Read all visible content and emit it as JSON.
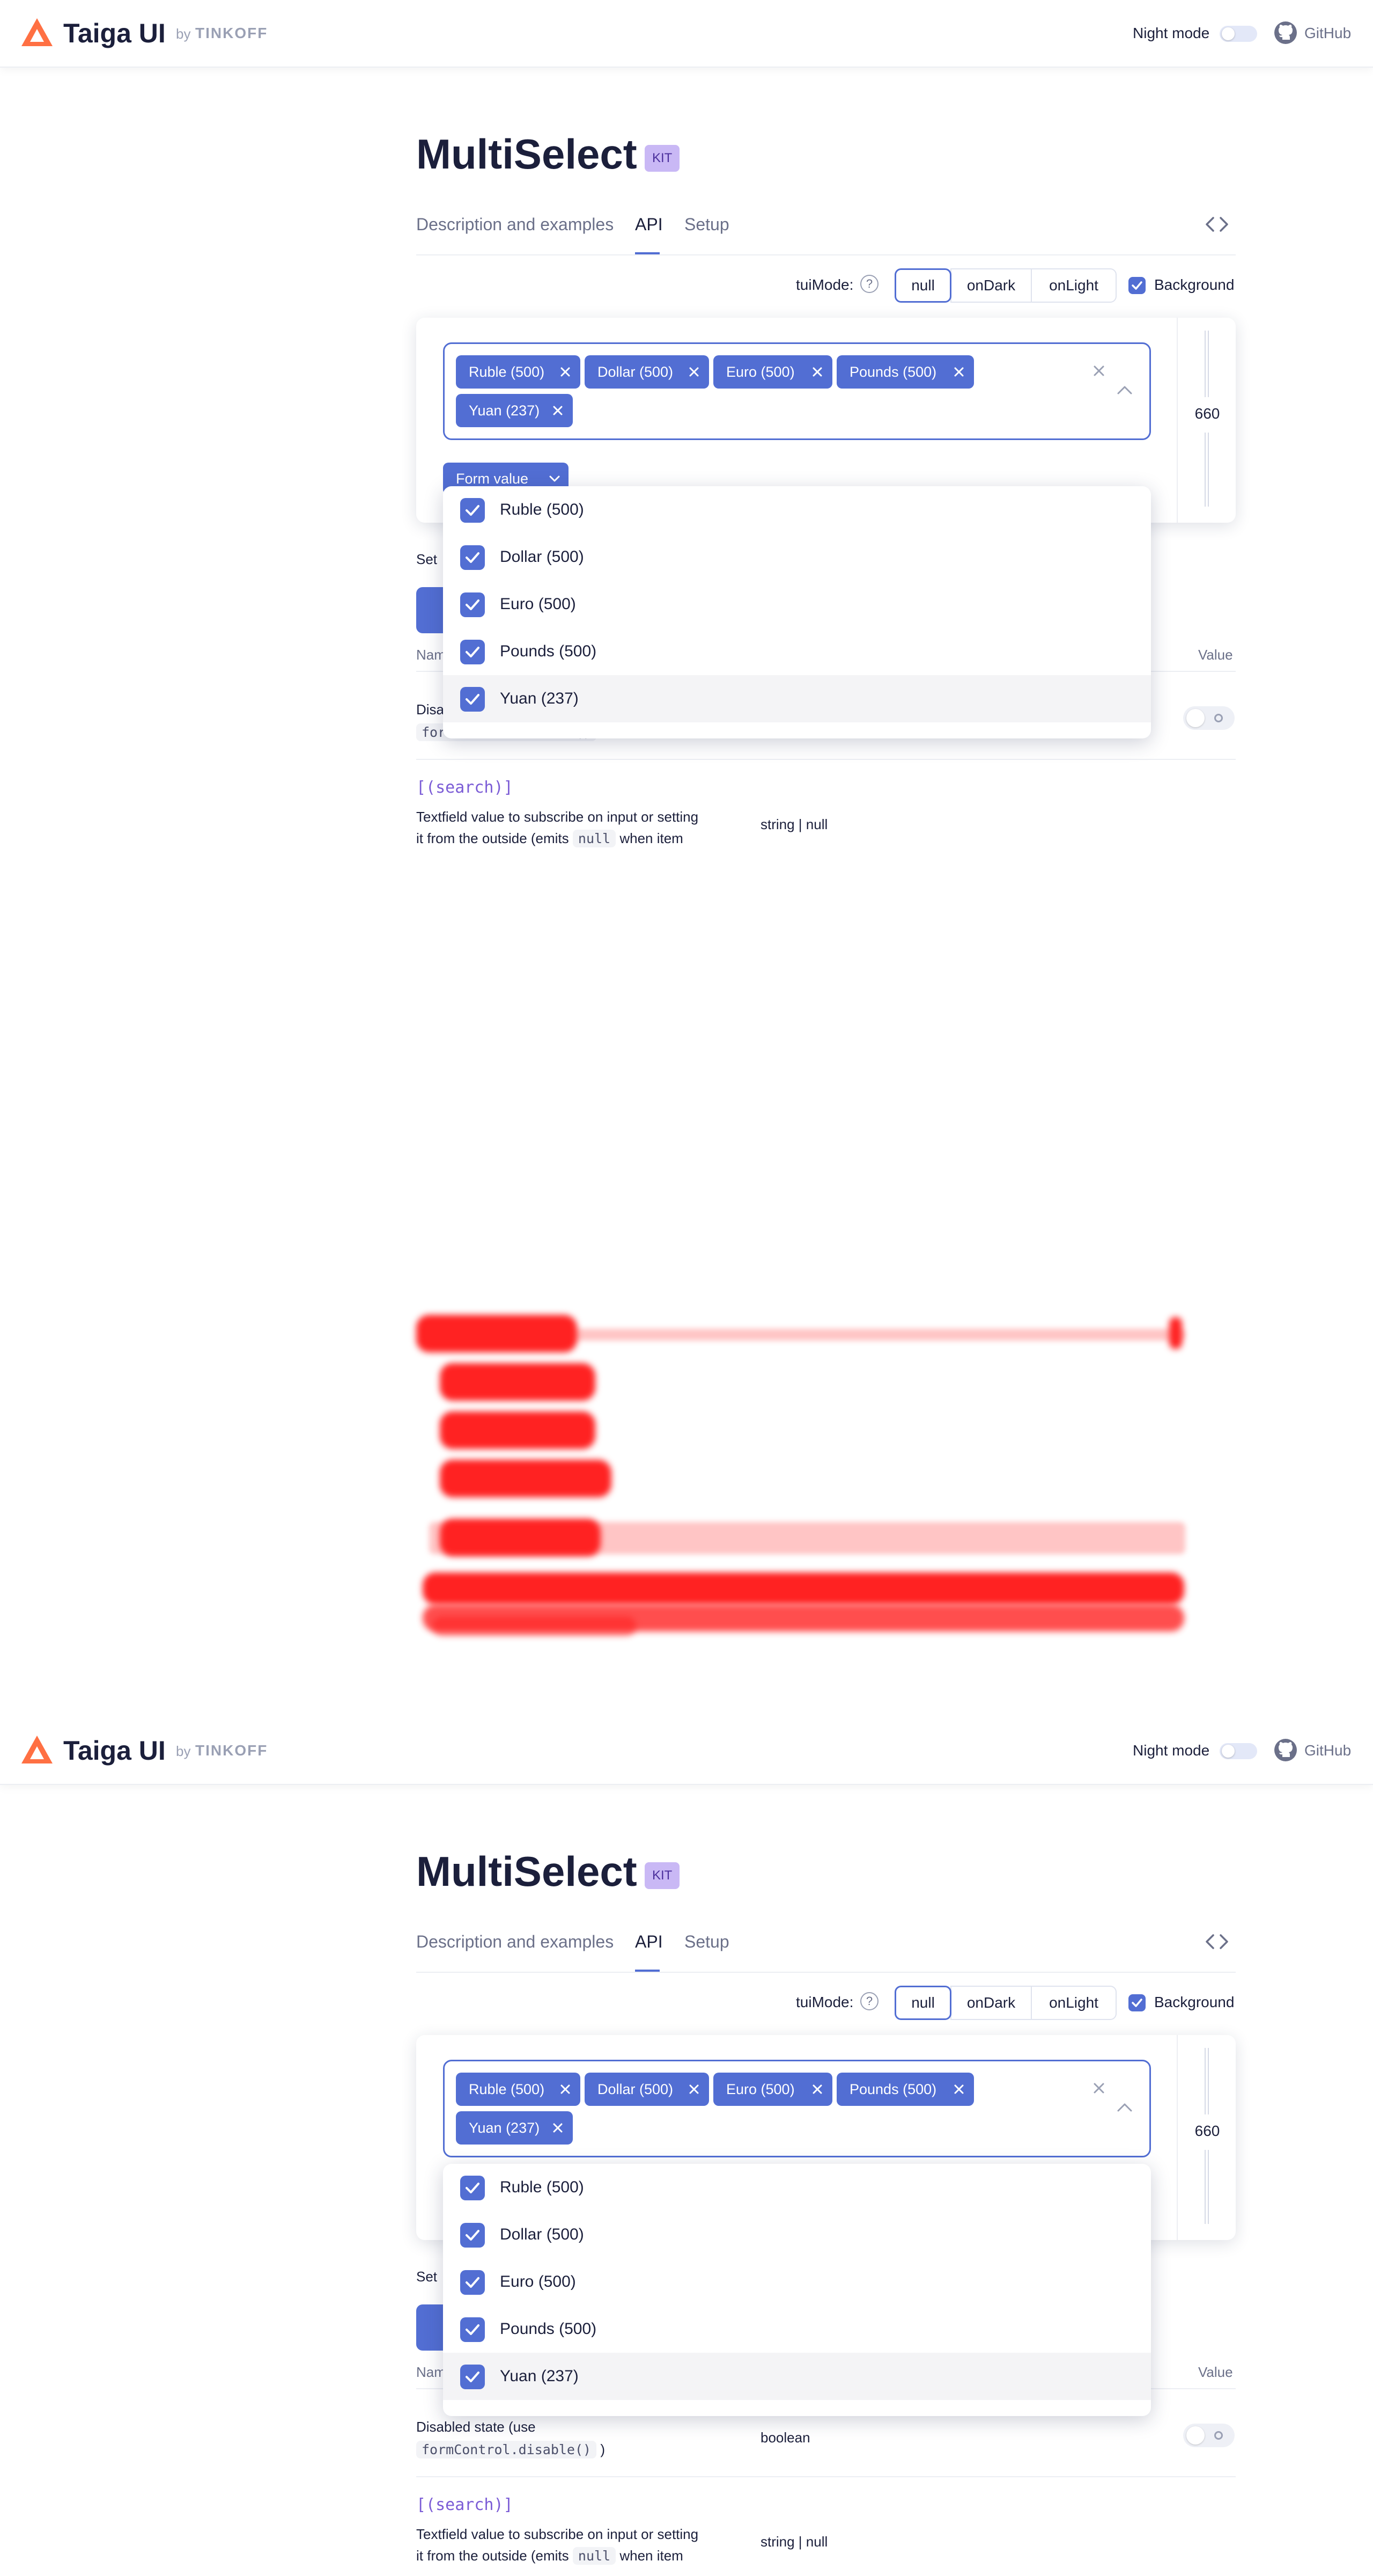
{
  "header": {
    "logo_text": "Taiga UI",
    "by": "by",
    "tinkoff": "TINKOFF",
    "night_mode": "Night mode",
    "github": "GitHub"
  },
  "page": {
    "title": "MultiSelect",
    "badge": "KIT",
    "tabs": [
      "Description and examples",
      "API",
      "Setup"
    ],
    "active_tab": "API"
  },
  "mode": {
    "label": "tuiMode:",
    "options": [
      "null",
      "onDark",
      "onLight"
    ],
    "selected": "null",
    "background_label": "Background",
    "background_checked": true
  },
  "demo": {
    "tags": [
      "Ruble (500)",
      "Dollar (500)",
      "Euro (500)",
      "Pounds (500)",
      "Yuan (237)"
    ],
    "width_value": "660",
    "form_value_button": "Form value"
  },
  "dropdown": {
    "items": [
      {
        "label": "Ruble (500)",
        "checked": true
      },
      {
        "label": "Dollar (500)",
        "checked": true
      },
      {
        "label": "Euro (500)",
        "checked": true
      },
      {
        "label": "Pounds (500)",
        "checked": true
      },
      {
        "label": "Yuan (237)",
        "checked": true
      }
    ],
    "hovered": "Yuan (237)"
  },
  "api": {
    "set_text": "Set",
    "name_header": "Nam",
    "value_header": "Value",
    "disabled_row": {
      "name_line1": "Disabled state (use",
      "code": "formControl.disable()",
      "after": ")",
      "type": "boolean",
      "value": false
    },
    "search_row": {
      "name": "[(search)]",
      "desc_line1": "Textfield value to subscribe on input or setting",
      "desc_line2_prefix": "it from the outside (emits",
      "desc_code": "null",
      "desc_line2_suffix": "when item",
      "type": "string | null"
    }
  },
  "colors": {
    "accent": "#526ed3",
    "text": "#1b1f3b",
    "muted": "#6b7089",
    "badge_bg": "#c9b8f5",
    "diff": "#ff2222"
  }
}
